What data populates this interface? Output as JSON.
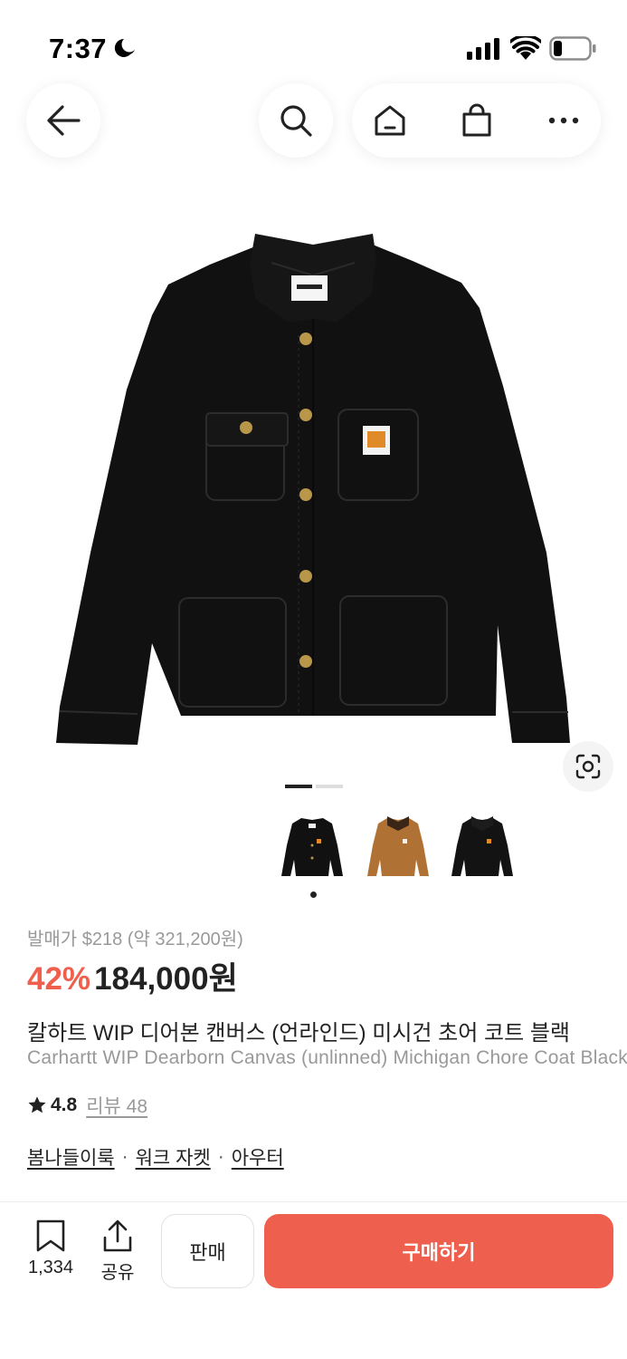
{
  "status_bar": {
    "time": "7:37"
  },
  "product": {
    "original_price": "발매가 $218 (약 321,200원)",
    "discount": "42%",
    "price": "184,000원",
    "title_ko": "칼하트 WIP 디어본 캔버스 (언라인드) 미시건 초어 코트 블랙",
    "title_en": "Carhartt WIP Dearborn Canvas (unlinned) Michigan Chore Coat Black",
    "rating": "4.8",
    "reviews": "리뷰 48",
    "categories": [
      "봄나들이룩",
      "워크 자켓",
      "아우터"
    ],
    "category_separator": "·"
  },
  "bottom_bar": {
    "bookmark_count": "1,334",
    "share_label": "공유",
    "sell_label": "판매",
    "buy_label": "구매하기"
  },
  "colors": {
    "accent": "#ef5f4d",
    "text": "#222222",
    "muted": "#999999"
  },
  "icons": [
    "back-arrow-icon",
    "search-icon",
    "home-icon",
    "shopping-bag-icon",
    "more-icon",
    "scan-icon",
    "star-icon",
    "bookmark-icon",
    "share-icon"
  ]
}
